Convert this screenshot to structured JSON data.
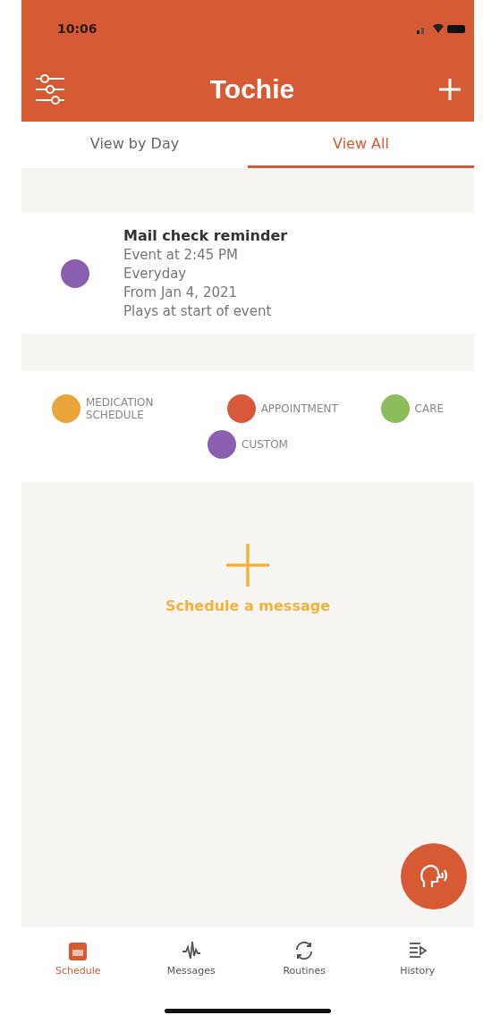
{
  "status_bar": {
    "time": "10:06"
  },
  "header": {
    "title": "Tochie"
  },
  "tabs": [
    {
      "label": "View by Day",
      "selected": false
    },
    {
      "label": "View All",
      "selected": true
    }
  ],
  "events": [
    {
      "title": "Mail check reminder",
      "color": "#8a5fb0",
      "lines": [
        "Event at 2:45 PM",
        "Everyday",
        "From Jan 4, 2021",
        "Plays at start of event"
      ]
    }
  ],
  "legend": [
    {
      "label": "MEDICATION SCHEDULE",
      "color": "#e9a53a"
    },
    {
      "label": "APPOINTMENT",
      "color": "#d9573a"
    },
    {
      "label": "CARE",
      "color": "#8cbd5a"
    },
    {
      "label": "CUSTOM",
      "color": "#8a5fb0"
    }
  ],
  "empty_action": {
    "label": "Schedule a message"
  },
  "bottom_nav": [
    {
      "label": "Schedule",
      "selected": true,
      "kind": "calendar"
    },
    {
      "label": "Messages",
      "selected": false,
      "kind": "wave"
    },
    {
      "label": "Routines",
      "selected": false,
      "kind": "cycle"
    },
    {
      "label": "History",
      "selected": false,
      "kind": "list"
    }
  ]
}
